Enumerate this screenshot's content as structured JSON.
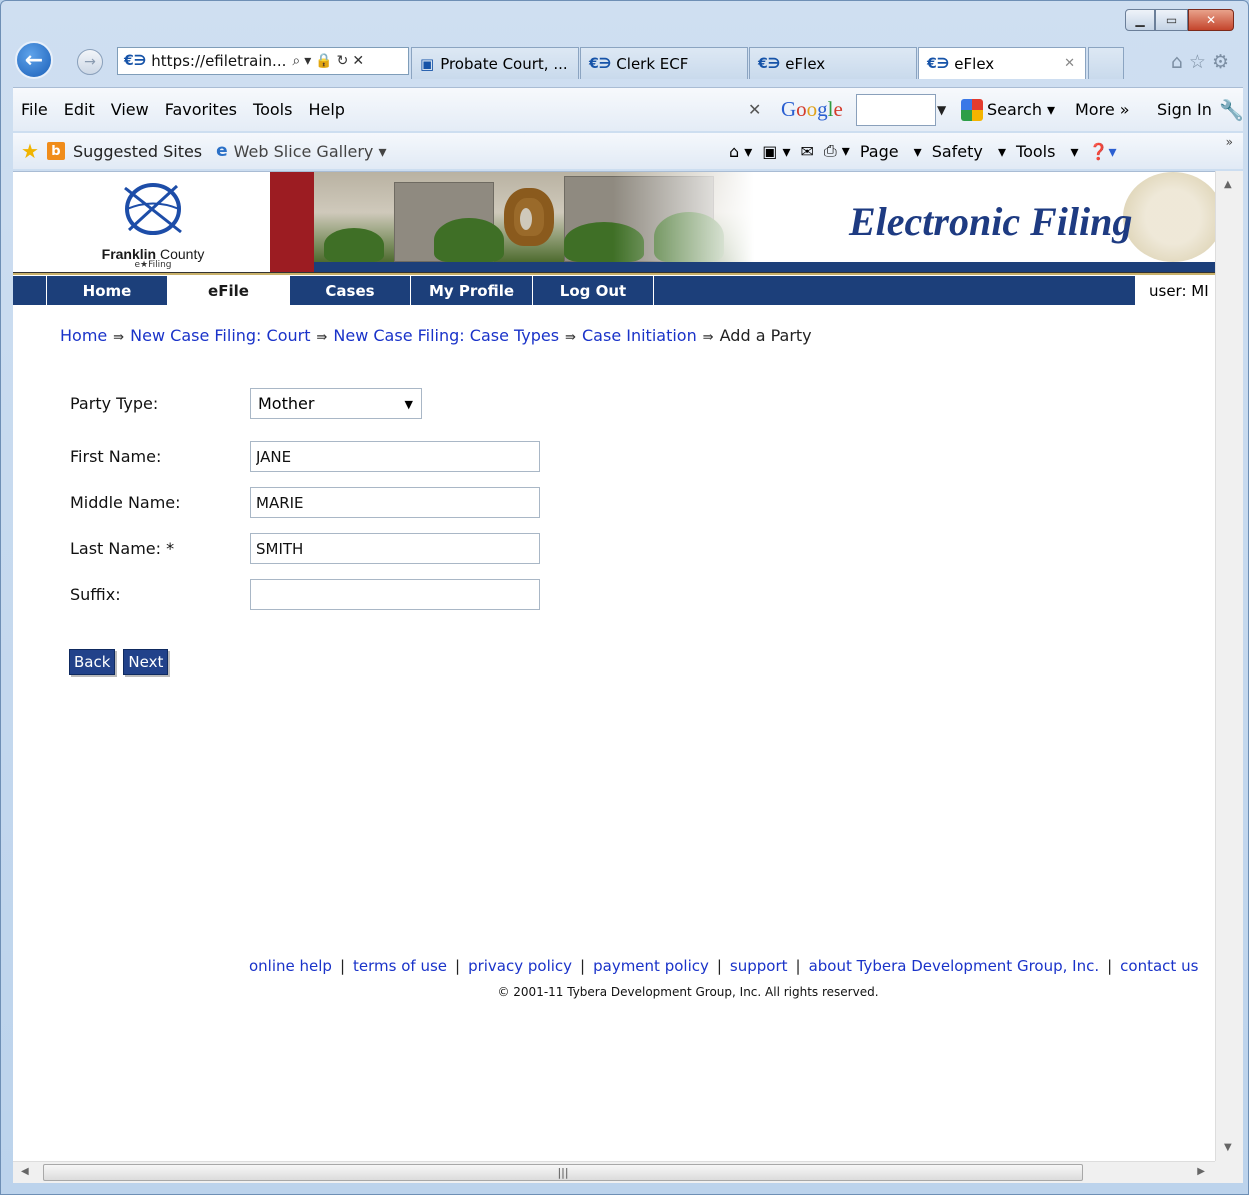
{
  "browser": {
    "address": "https://efiletrain...",
    "tabs": [
      {
        "label": "Probate Court, ..."
      },
      {
        "label": "Clerk ECF"
      },
      {
        "label": "eFlex"
      },
      {
        "label": "eFlex"
      }
    ],
    "menu": [
      "File",
      "Edit",
      "View",
      "Favorites",
      "Tools",
      "Help"
    ],
    "google": {
      "logo": "Google",
      "search": "Search",
      "more": "More »",
      "signin": "Sign In"
    },
    "favorites": {
      "suggested": "Suggested Sites",
      "gallery": "Web Slice Gallery"
    },
    "commands": {
      "page": "Page",
      "safety": "Safety",
      "tools": "Tools"
    }
  },
  "site": {
    "logo_name_bold": "Franklin",
    "logo_name_rest": " County",
    "logo_sub": "e★Filing",
    "header_title": "Electronic Filing",
    "nav": [
      "Home",
      "eFile",
      "Cases",
      "My Profile",
      "Log Out"
    ],
    "user": "user: MI"
  },
  "breadcrumb": {
    "links": [
      "Home",
      "New Case Filing: Court",
      "New Case Filing: Case Types",
      "Case Initiation"
    ],
    "separator": "⇛",
    "current": "Add a Party"
  },
  "form": {
    "party_type_label": "Party Type:",
    "party_type_value": "Mother",
    "first_name_label": "First Name:",
    "first_name_value": "JANE",
    "middle_name_label": "Middle Name:",
    "middle_name_value": "MARIE",
    "last_name_label": "Last Name: *",
    "last_name_value": "SMITH",
    "suffix_label": "Suffix:",
    "suffix_value": "",
    "back_label": "Back",
    "next_label": "Next"
  },
  "footer": {
    "links": [
      "online help",
      "terms of use",
      "privacy policy",
      "payment policy",
      "support",
      "about Tybera Development Group, Inc.",
      "contact us"
    ],
    "copyright": "© 2001-11 Tybera Development Group, Inc. All rights reserved."
  }
}
